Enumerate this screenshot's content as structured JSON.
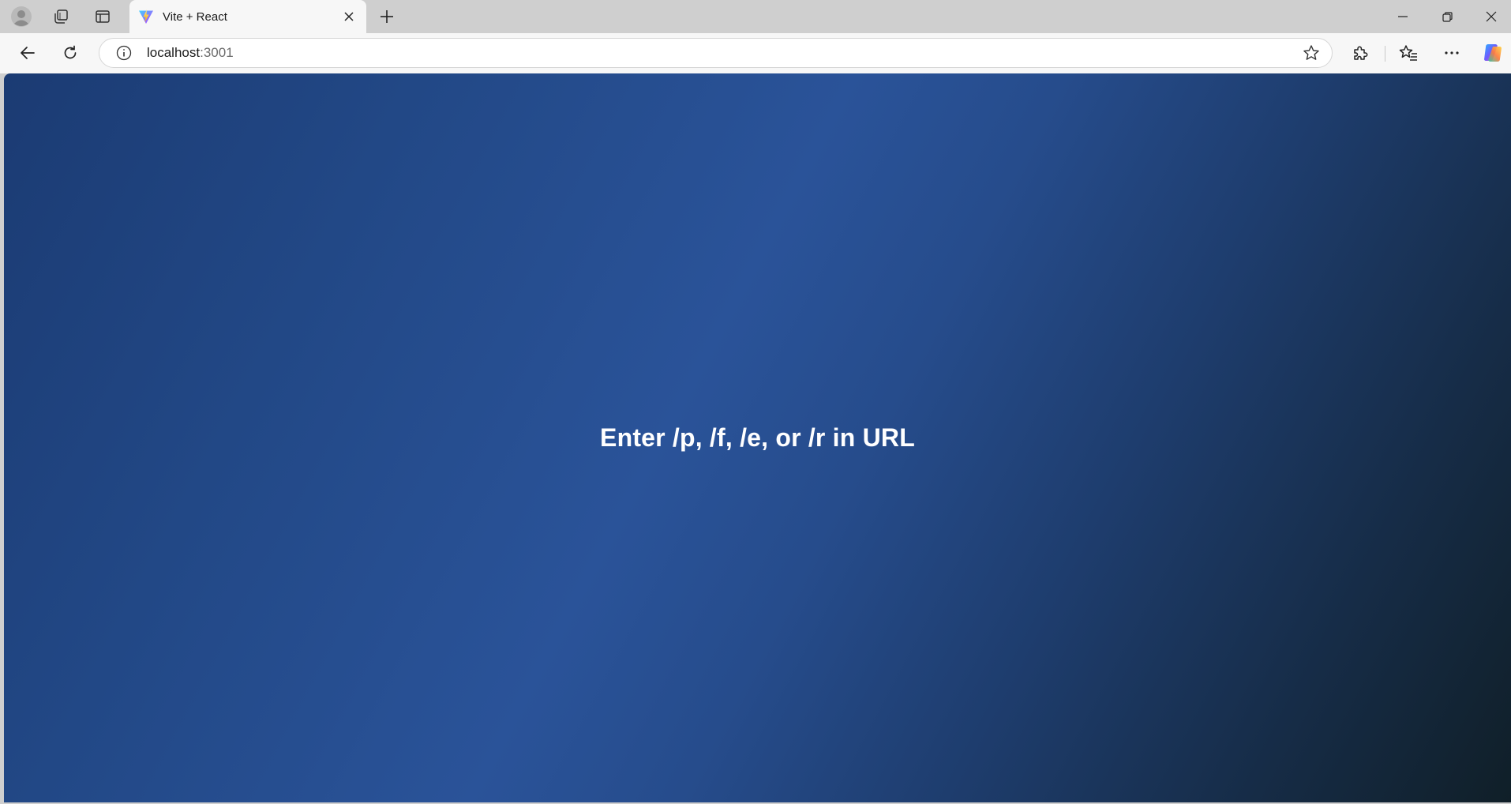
{
  "browser": {
    "tab": {
      "title": "Vite + React",
      "favicon": "vite-logo-icon"
    },
    "address_bar": {
      "host": "localhost",
      "port": ":3001"
    },
    "icons": {
      "profile": "profile-avatar-icon",
      "workspaces": "workspaces-icon",
      "tab_actions": "vertical-tabs-icon",
      "new_tab": "plus-icon",
      "back": "back-arrow-icon",
      "refresh": "refresh-icon",
      "site_info": "info-icon",
      "favorite": "star-icon",
      "extensions": "puzzle-icon",
      "favorites": "favorites-list-icon",
      "more": "more-horizontal-icon",
      "copilot": "copilot-icon",
      "minimize": "minimize-icon",
      "restore": "restore-icon",
      "close": "close-icon"
    }
  },
  "page": {
    "message": "Enter /p, /f, /e, or /r in URL",
    "colors": {
      "gradient_start": "#1b3b73",
      "gradient_mid": "#2a5399",
      "gradient_end": "#101f28",
      "text": "#ffffff"
    }
  }
}
